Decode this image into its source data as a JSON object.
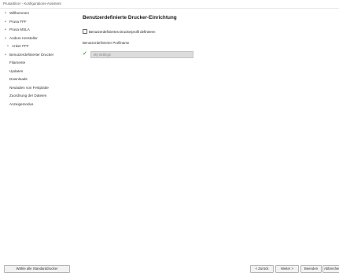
{
  "window": {
    "title": "PrusaSlicer - Konfigurations-Assistent"
  },
  "sidebar": {
    "items": [
      {
        "label": "Willkommen",
        "icon": "bullet-icon",
        "level": 0
      },
      {
        "label": "Prusa FFF",
        "icon": "bullet-icon",
        "level": 0
      },
      {
        "label": "Prusa MSLA",
        "icon": "bullet-icon",
        "level": 0
      },
      {
        "label": "Andere Hersteller",
        "icon": "bullet-icon",
        "level": 0
      },
      {
        "label": "Anker FFF",
        "icon": "bullet-icon",
        "level": 1
      },
      {
        "label": "Benutzerdefinierter Drucker",
        "icon": "current-page-icon",
        "level": 0
      },
      {
        "label": "Filamente",
        "icon": "",
        "level": 0
      },
      {
        "label": "Updates",
        "icon": "",
        "level": 0
      },
      {
        "label": "Downloads",
        "icon": "",
        "level": 0
      },
      {
        "label": "Neuladen von Festplatte",
        "icon": "",
        "level": 0
      },
      {
        "label": "Zuordnung der Dateien",
        "icon": "",
        "level": 0
      },
      {
        "label": "Anzeigemodus",
        "icon": "",
        "level": 0
      }
    ]
  },
  "page": {
    "heading": "Benutzerdefinierte Drucker-Einrichtung",
    "checkbox_label": "Benutzerdefiniertes Druckerprofil definieren",
    "checkbox_checked": false,
    "profile_name_label": "Benutzerdefinierter Profilname",
    "profile_name_value": "My Settings",
    "profile_name_enabled": false,
    "profile_name_status_icon": "valid-check-icon"
  },
  "footer": {
    "select_all_label": "Wähle alle Standarddrucker",
    "back_label": "< Zurück",
    "next_label": "Weiter >",
    "finish_label": "Beenden",
    "cancel_label": "Abbrechen"
  },
  "colors": {
    "current_page_marker": "#2f7fd0",
    "valid_check": "#3cad3c",
    "field_background": "#dcdcdc"
  }
}
